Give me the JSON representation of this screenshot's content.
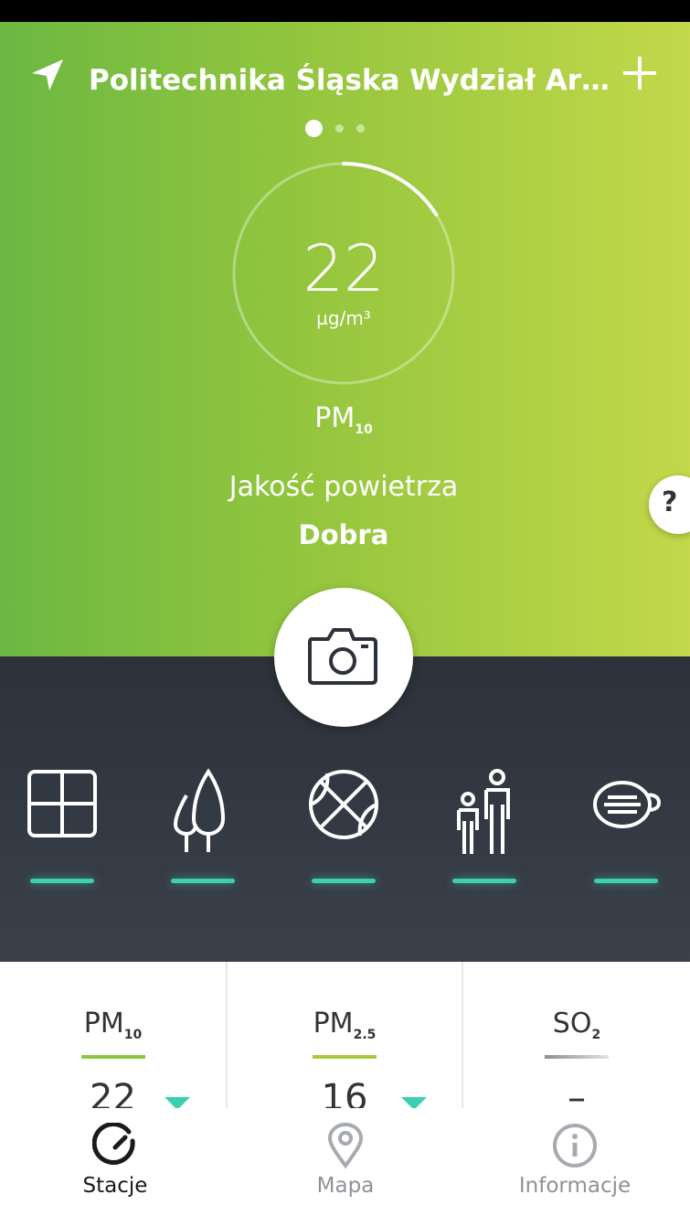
{
  "header": {
    "station_name": "Politechnika Śląska Wydział Archite...",
    "location_icon": "navigation-arrow-icon",
    "add_icon": "plus-icon",
    "pager": {
      "pages": 3,
      "active_index": 0
    }
  },
  "summary": {
    "value": "22",
    "unit": "µg/m³",
    "pollutant_main": "PM",
    "pollutant_sub": "10",
    "air_quality_label": "Jakość powietrza",
    "air_quality_value": "Dobra",
    "gauge_fraction": 0.16,
    "help_label": "?"
  },
  "camera": {
    "icon": "camera-icon"
  },
  "categories": [
    {
      "icon": "window-icon"
    },
    {
      "icon": "trees-icon"
    },
    {
      "icon": "ball-icon"
    },
    {
      "icon": "family-icon"
    },
    {
      "icon": "mask-icon"
    }
  ],
  "measurements": [
    {
      "main": "PM",
      "sub": "10",
      "value": "22",
      "line_color": "#8cc63f",
      "trend": "down"
    },
    {
      "main": "PM",
      "sub": "2.5",
      "value": "16",
      "line_color": "#a7c940",
      "trend": "down"
    },
    {
      "main": "SO",
      "sub": "2",
      "value": "–",
      "line_color": "#9aa0a6",
      "trend": ""
    }
  ],
  "nav": {
    "items": [
      {
        "label": "Stacje",
        "icon": "gauge-icon",
        "active": true
      },
      {
        "label": "Mapa",
        "icon": "map-pin-icon",
        "active": false
      },
      {
        "label": "Informacje",
        "icon": "info-icon",
        "active": false
      }
    ]
  },
  "colors": {
    "hero_start": "#6cb842",
    "hero_end": "#c3d84a",
    "dark_panel": "#2c313a",
    "accent_teal": "#3ccfb0"
  }
}
